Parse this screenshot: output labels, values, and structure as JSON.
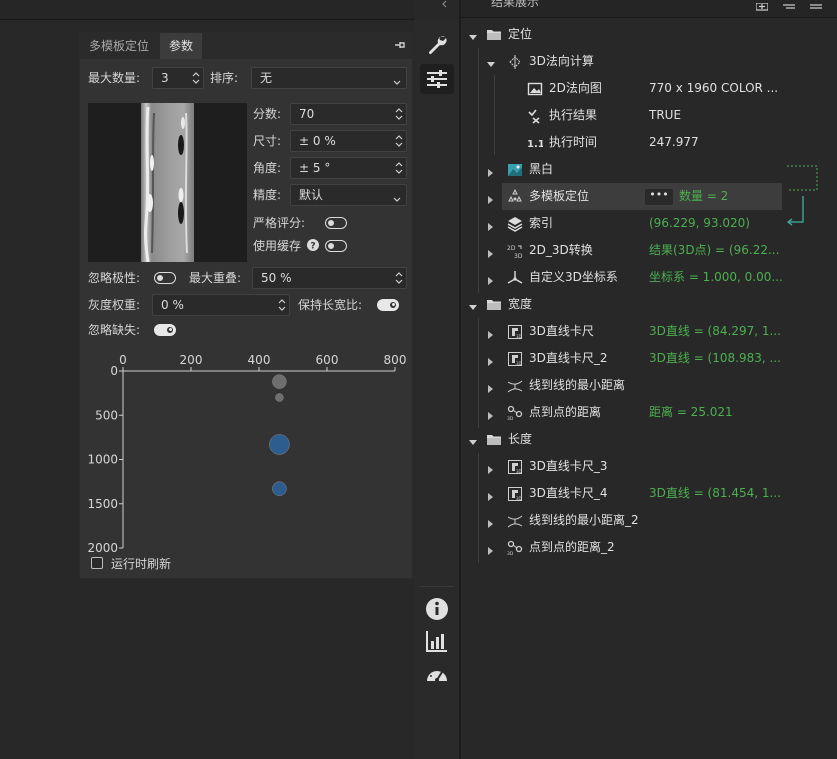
{
  "panel": {
    "tabs": [
      "多模板定位",
      "参数"
    ],
    "active_tab": 1,
    "max_count_label": "最大数量:",
    "max_count_value": "3",
    "sort_label": "排序:",
    "sort_value": "无",
    "score_label": "分数:",
    "score_value": "70",
    "size_label": "尺寸:",
    "size_value": "± 0 %",
    "angle_label": "角度:",
    "angle_value": "± 5 °",
    "precision_label": "精度:",
    "precision_value": "默认",
    "strict_label": "严格评分:",
    "strict_on": false,
    "cache_label": "使用缓存",
    "cache_on": false,
    "ignore_polarity_label": "忽略极性:",
    "ignore_polarity_on": false,
    "max_overlap_label": "最大重叠:",
    "max_overlap_value": "50 %",
    "gray_weight_label": "灰度权重:",
    "gray_weight_value": "0 %",
    "keep_aspect_label": "保持长宽比:",
    "keep_aspect_on": true,
    "ignore_missing_label": "忽略缺失:",
    "ignore_missing_on": true,
    "refresh_label": "运行时刷新",
    "refresh_checked": false
  },
  "chart_data": {
    "type": "scatter",
    "title": "",
    "xlabel": "",
    "ylabel": "",
    "xlim": [
      0,
      800
    ],
    "ylim": [
      0,
      2000
    ],
    "y_inverted": true,
    "x_ticks": [
      "0",
      "200",
      "400",
      "600",
      "800"
    ],
    "y_ticks": [
      "0",
      "500",
      "1000",
      "1500",
      "2000"
    ],
    "points": [
      {
        "x": 460,
        "y": 120,
        "size": "small",
        "color": "#6e6e6e"
      },
      {
        "x": 460,
        "y": 300,
        "size": "tiny",
        "color": "#6e6e6e"
      },
      {
        "x": 460,
        "y": 830,
        "size": "large",
        "color": "#2d5c8f"
      },
      {
        "x": 460,
        "y": 1330,
        "size": "small",
        "color": "#2d5c8f"
      }
    ]
  },
  "toolbar": {
    "tools": [
      "wrench-icon",
      "sliders-icon",
      "info-icon",
      "bar-chart-icon",
      "gauge-icon"
    ]
  },
  "tree": {
    "title": "结果展示",
    "rows": [
      {
        "name": "定位",
        "value": "",
        "green": false
      },
      {
        "name": "3D法向计算",
        "value": "",
        "green": false
      },
      {
        "name": "2D法向图",
        "value": "770 x 1960 COLOR ...",
        "green": false
      },
      {
        "name": "执行结果",
        "value": "TRUE",
        "green": false
      },
      {
        "name": "执行时间",
        "value": "247.977",
        "green": false
      },
      {
        "name": "黑白",
        "value": "",
        "green": false
      },
      {
        "name": "多模板定位",
        "value": "数量 = 2",
        "green": true
      },
      {
        "name": "索引",
        "value": "(96.229, 93.020)",
        "green": true
      },
      {
        "name": "2D_3D转换",
        "value": "结果(3D点) = (96.22...",
        "green": true
      },
      {
        "name": "自定义3D坐标系",
        "value": "坐标系 = 1.000, 0.00...",
        "green": true
      },
      {
        "name": "宽度",
        "value": "",
        "green": false
      },
      {
        "name": "3D直线卡尺",
        "value": "3D直线 = (84.297, 1...",
        "green": true
      },
      {
        "name": "3D直线卡尺_2",
        "value": "3D直线 = (108.983, ...",
        "green": true
      },
      {
        "name": "线到线的最小距离",
        "value": "",
        "green": false
      },
      {
        "name": "点到点的距离",
        "value": "距离 = 25.021",
        "green": true
      },
      {
        "name": "长度",
        "value": "",
        "green": false
      },
      {
        "name": "3D直线卡尺_3",
        "value": "",
        "green": false
      },
      {
        "name": "3D直线卡尺_4",
        "value": "3D直线 = (81.454, 1...",
        "green": true
      },
      {
        "name": "线到线的最小距离_2",
        "value": "",
        "green": false
      },
      {
        "name": "点到点的距离_2",
        "value": "",
        "green": false
      }
    ]
  },
  "colors": {
    "accent_green": "#4caf50",
    "marker_blue": "#2d5c8f",
    "marker_gray": "#6e6e6e"
  }
}
